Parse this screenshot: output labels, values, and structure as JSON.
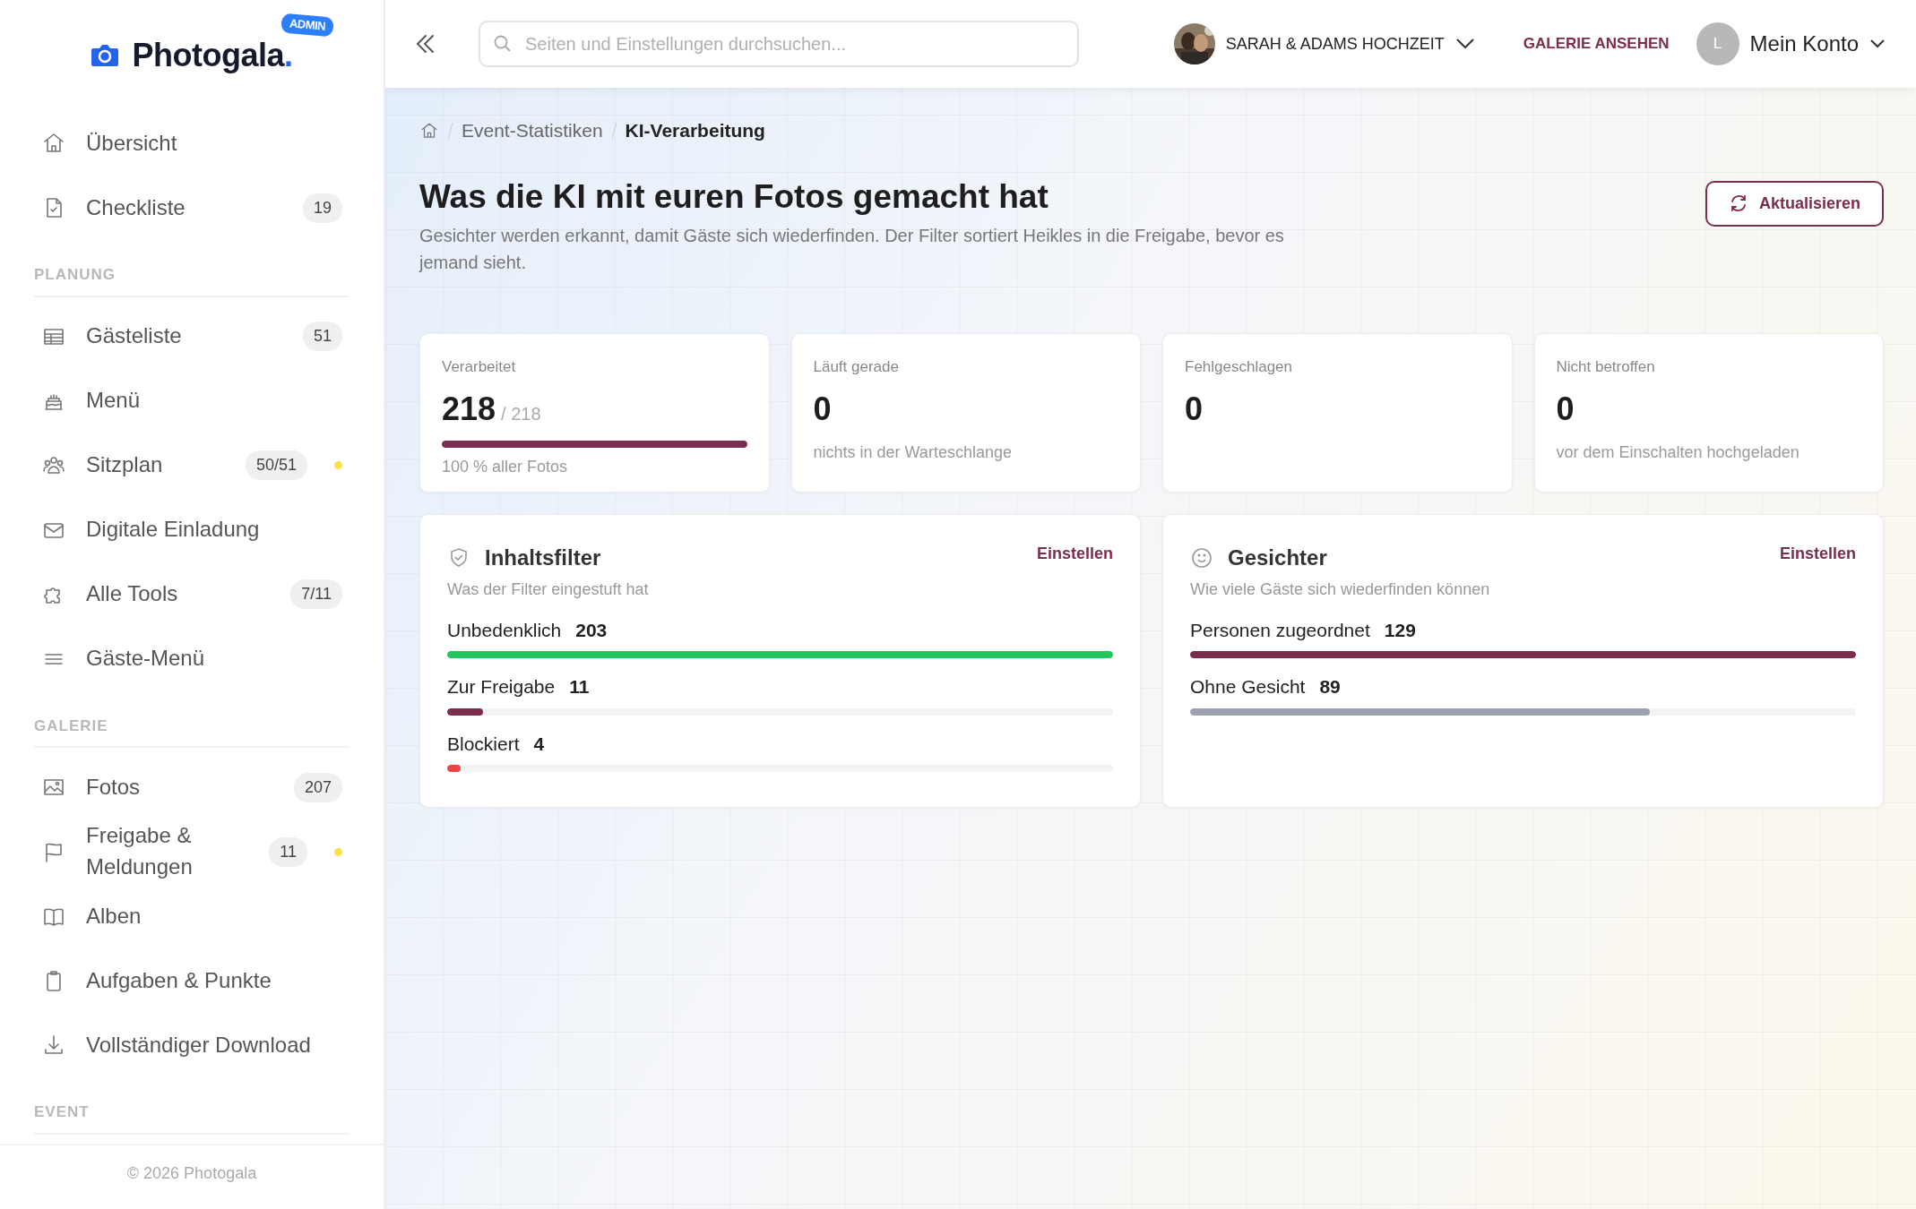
{
  "brand": {
    "name": "Photogala",
    "dot": ".",
    "badge": "ADMIN"
  },
  "sidebar": {
    "items": [
      {
        "kind": "item",
        "label": "Übersicht",
        "attention": false
      },
      {
        "kind": "item",
        "label": "Checkliste",
        "count": "19",
        "attention": false
      },
      {
        "kind": "section",
        "label": "PLANUNG"
      },
      {
        "kind": "item",
        "label": "Gästeliste",
        "count": "51",
        "attention": false
      },
      {
        "kind": "item",
        "label": "Menü",
        "attention": false
      },
      {
        "kind": "item",
        "label": "Sitzplan",
        "count": "50/51",
        "attention": true
      },
      {
        "kind": "item",
        "label": "Digitale Einladung",
        "attention": false
      },
      {
        "kind": "item",
        "label": "Alle Tools",
        "count": "7/11",
        "attention": false
      },
      {
        "kind": "item",
        "label": "Gäste-Menü",
        "attention": false
      },
      {
        "kind": "section",
        "label": "GALERIE"
      },
      {
        "kind": "item",
        "label": "Fotos",
        "count": "207",
        "attention": false
      },
      {
        "kind": "item",
        "label": "Freigabe & Meldungen",
        "count": "11",
        "attention": true
      },
      {
        "kind": "item",
        "label": "Alben",
        "attention": false
      },
      {
        "kind": "item",
        "label": "Aufgaben & Punkte",
        "attention": false
      },
      {
        "kind": "item",
        "label": "Vollständiger Download",
        "attention": false
      },
      {
        "kind": "section",
        "label": "EVENT"
      }
    ],
    "footer": "© 2026 Photogala"
  },
  "topbar": {
    "search": {
      "placeholder": "Seiten und Einstellungen durchsuchen..."
    },
    "event": "SARAH & ADAMS HOCHZEIT",
    "gallery_link": "GALERIE ANSEHEN",
    "account": {
      "initial": "L",
      "label": "Mein Konto"
    }
  },
  "breadcrumb": [
    "Event-Statistiken",
    "KI-Verarbeitung"
  ],
  "page": {
    "title": "Was die KI mit euren Fotos gemacht hat",
    "subtitle": "Gesichter werden erkannt, damit Gäste sich wiederfinden. Der Filter sortiert Heikles in die Freigabe, bevor es jemand sieht.",
    "refresh": "Aktualisieren"
  },
  "stats": [
    {
      "label": "Verarbeitet",
      "value": "218",
      "total": "/ 218",
      "level": 1.0,
      "note": "100 % aller Fotos"
    },
    {
      "label": "Läuft gerade",
      "value": "0",
      "note": "nichts in der Warteschlange"
    },
    {
      "label": "Fehlgeschlagen",
      "value": "0"
    },
    {
      "label": "Nicht betroffen",
      "value": "0",
      "note": "vor dem Einschalten hochgeladen"
    }
  ],
  "panels": [
    {
      "title": "Inhaltsfilter",
      "action": "Einstellen",
      "subtitle": "Was der Filter eingestuft hat",
      "rows": [
        {
          "label": "Unbedenklich",
          "value": "203",
          "level": 1.0,
          "color": "#22c55e"
        },
        {
          "label": "Zur Freigabe",
          "value": "11",
          "level": 0.054,
          "color": "#7b2d4e"
        },
        {
          "label": "Blockiert",
          "value": "4",
          "level": 0.02,
          "color": "#ef4444"
        }
      ]
    },
    {
      "title": "Gesichter",
      "action": "Einstellen",
      "subtitle": "Wie viele Gäste sich wiederfinden können",
      "rows": [
        {
          "label": "Personen zugeordnet",
          "value": "129",
          "level": 1.0,
          "color": "#7b2d4e"
        },
        {
          "label": "Ohne Gesicht",
          "value": "89",
          "level": 0.69,
          "color": "#9ca3af"
        }
      ]
    }
  ]
}
